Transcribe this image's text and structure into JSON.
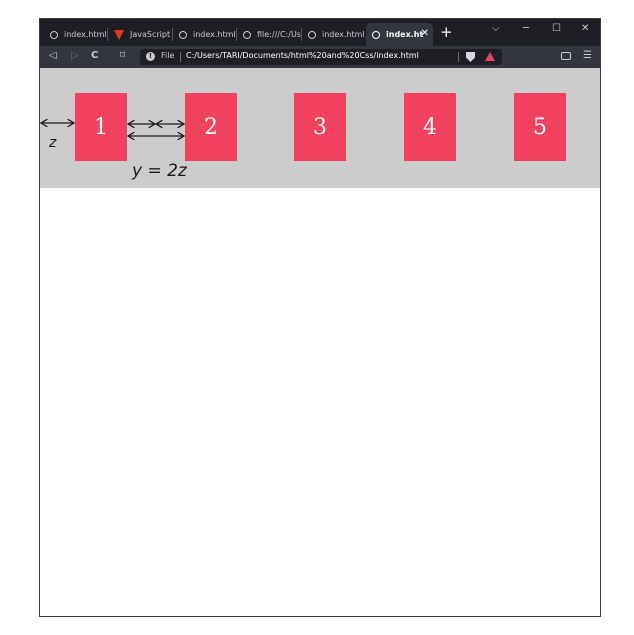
{
  "tabs": [
    {
      "title": "index.html",
      "icon": "globe-icon"
    },
    {
      "title": "JavaScript o",
      "icon": "vivaldi-icon"
    },
    {
      "title": "index.html",
      "icon": "globe-icon"
    },
    {
      "title": "file:///C:/Us",
      "icon": "globe-icon"
    },
    {
      "title": "index.html",
      "icon": "globe-icon"
    },
    {
      "title": "index.ht",
      "icon": "globe-icon",
      "active": true
    }
  ],
  "window_controls": {
    "tab_list": "⌵",
    "minimize": "─",
    "maximize": "☐",
    "close": "✕"
  },
  "newtab_label": "+",
  "toolbar": {
    "back": "◁",
    "forward": "▷",
    "reload": "C",
    "bookmark": "⌑",
    "menu": "☰"
  },
  "address": {
    "scheme_label": "File",
    "url": "C:/Users/TARI/Documents/html%20and%20Css/index.html"
  },
  "page": {
    "boxes": [
      "1",
      "2",
      "3",
      "4",
      "5"
    ]
  },
  "annotations": {
    "gap_label": "z",
    "equation": "y = 2z"
  },
  "colors": {
    "box": "#f0415f",
    "container": "#cccccc",
    "tabbar": "#1e1f25",
    "toolbar": "#33363e"
  }
}
